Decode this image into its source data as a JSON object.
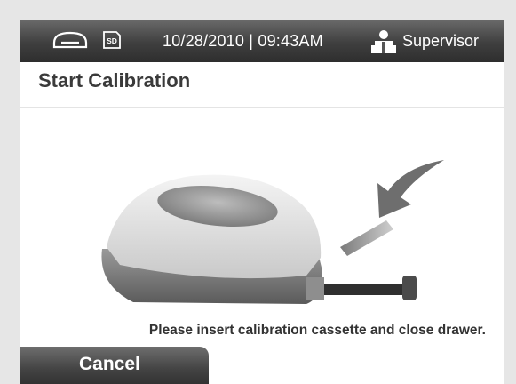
{
  "status_bar": {
    "datetime": "10/28/2010 | 09:43AM",
    "user": "Supervisor",
    "icons": [
      "drive-icon",
      "sd-card-icon",
      "user-icon"
    ],
    "sd_label": "SD"
  },
  "page": {
    "title": "Start Calibration",
    "instruction": "Please insert calibration cassette and close drawer."
  },
  "actions": {
    "cancel_label": "Cancel"
  },
  "colors": {
    "status_bar": "#3f3f3f",
    "background": "#e6e6e6",
    "title_text": "#3a3a3a"
  }
}
